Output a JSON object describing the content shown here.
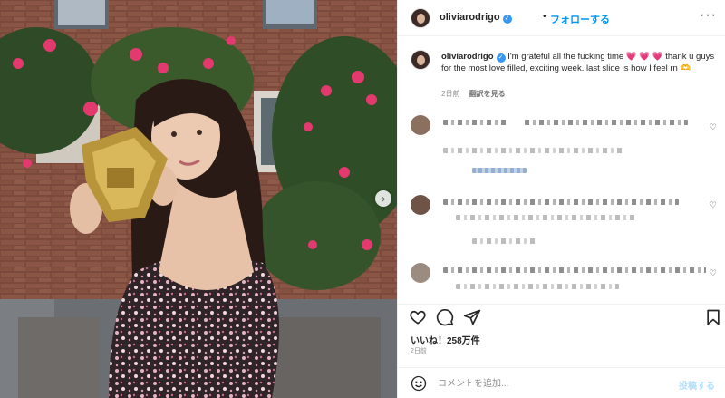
{
  "post": {
    "username": "oliviarodrigo",
    "follow_label": "フォローする",
    "dot": "•",
    "more_label": "···",
    "caption_username": "oliviarodrigo",
    "caption_text": "I'm grateful all the fucking time 💗 💗 💗 thank u guys for the most love filled, exciting week. last slide is how I feel rn 🫶",
    "caption_age": "2日前",
    "see_translation": "翻訳を見る",
    "likes": "いいね！258万件",
    "likes_time": "2日前",
    "comment_placeholder": "コメントを追加...",
    "post_button": "投稿する",
    "carousel_next": "›"
  },
  "icons": {
    "verified": "verified-badge-icon",
    "like": "heart-icon",
    "comment": "comment-bubble-icon",
    "share": "paper-plane-icon",
    "save": "bookmark-icon",
    "emoji": "smiley-icon"
  },
  "colors": {
    "accent": "#0095f6",
    "verified": "#3897f0",
    "post_disabled": "#b2dffc",
    "muted": "#8e8e8e"
  }
}
